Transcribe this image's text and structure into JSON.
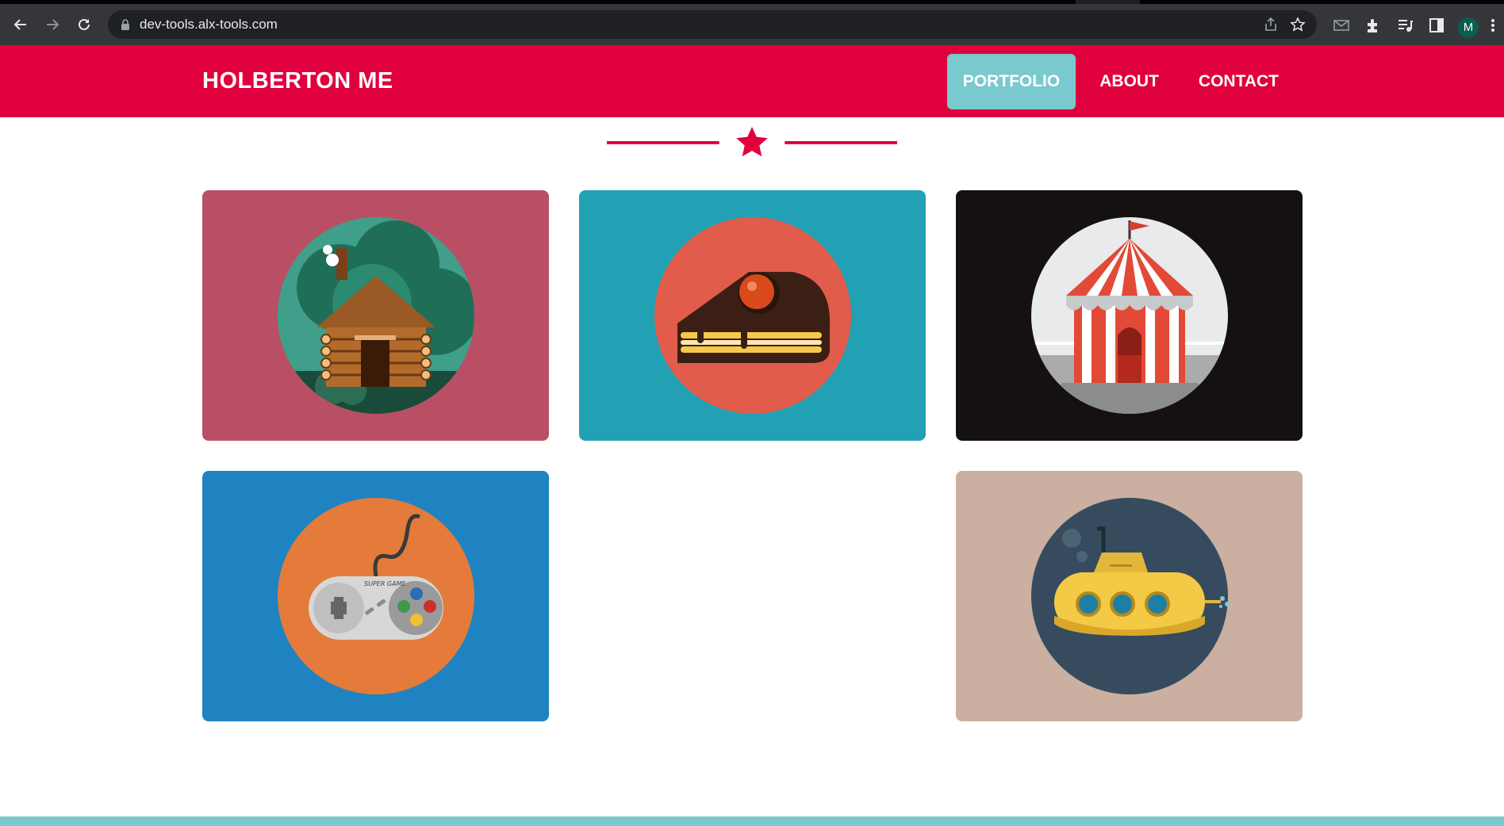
{
  "browser": {
    "url": "dev-tools.alx-tools.com",
    "profile_initial": "M",
    "icons": [
      "back-icon",
      "forward-icon",
      "reload-icon",
      "lock-icon",
      "share-icon",
      "bookmark-star-icon",
      "mail-extension-icon",
      "puzzle-extensions-icon",
      "media-control-icon",
      "side-panel-icon",
      "more-menu-icon"
    ]
  },
  "header": {
    "logo": "HOLBERTON ME",
    "nav": [
      {
        "label": "PORTFOLIO",
        "active": true
      },
      {
        "label": "ABOUT",
        "active": false
      },
      {
        "label": "CONTACT",
        "active": false
      }
    ]
  },
  "divider": {
    "icon": "star-icon"
  },
  "portfolio": {
    "items": [
      {
        "name": "cabin",
        "bg": "#b94f65",
        "circle": "#3f9f8a"
      },
      {
        "name": "cake",
        "bg": "#22a1b5",
        "circle": "#e15c4b"
      },
      {
        "name": "circus",
        "bg": "#141110",
        "circle": "#e8eaeb"
      },
      {
        "name": "game-controller",
        "bg": "#1f83c1",
        "circle": "#e47b3a"
      },
      {
        "name": "submarine",
        "bg": "#cbafa1",
        "circle": "#364c5e"
      }
    ]
  },
  "controller_brand": "SUPER GAME",
  "colors": {
    "brand": "#e1003e",
    "accent": "#7ac9cf"
  }
}
